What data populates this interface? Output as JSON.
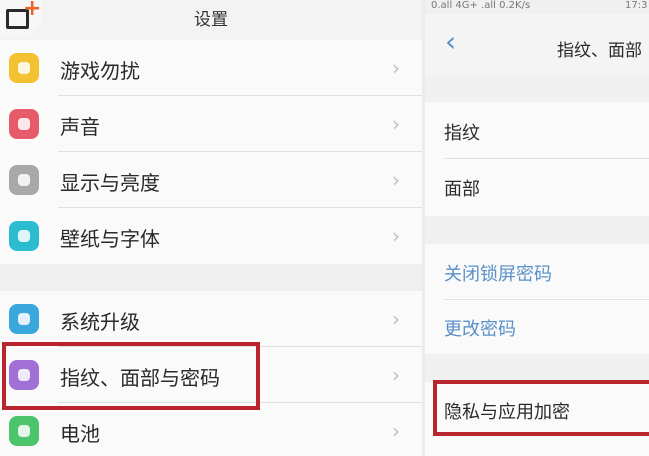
{
  "left": {
    "title": "设置",
    "group1": [
      {
        "label": "游戏勿扰",
        "icon": "game-icon",
        "color": "#f2c230"
      },
      {
        "label": "声音",
        "icon": "sound-icon",
        "color": "#e55b6a"
      },
      {
        "label": "显示与亮度",
        "icon": "display-icon",
        "color": "#a9a9a9"
      },
      {
        "label": "壁纸与字体",
        "icon": "wallpaper-icon",
        "color": "#2bbccf"
      }
    ],
    "group2": [
      {
        "label": "系统升级",
        "icon": "system-update-icon",
        "color": "#3aa8dc"
      },
      {
        "label": "指纹、面部与密码",
        "icon": "fingerprint-icon",
        "color": "#a070d6"
      },
      {
        "label": "电池",
        "icon": "battery-icon",
        "color": "#4cc46b"
      }
    ],
    "chevron": "›"
  },
  "right": {
    "status": {
      "signal": "0.all 4G+ .all 0.2K/s",
      "time": "17:3"
    },
    "back": "‹",
    "title": "指纹、面部",
    "group1": [
      "指纹",
      "面部"
    ],
    "group2": [
      "关闭锁屏密码",
      "更改密码"
    ],
    "group3": [
      "隐私与应用加密"
    ]
  },
  "colors": {
    "highlight": "#b8252c",
    "link": "#5a90c8"
  }
}
